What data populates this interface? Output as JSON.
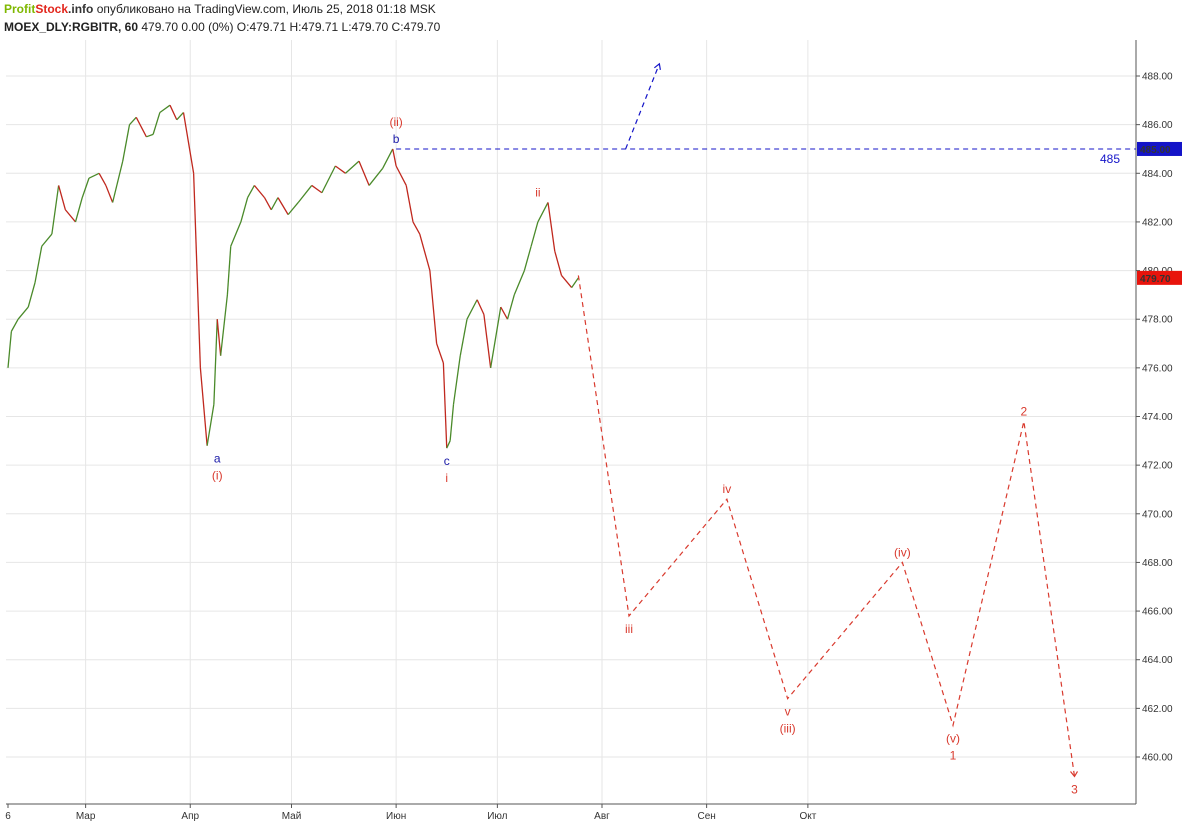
{
  "header": {
    "brand_profit": "Profit",
    "brand_stock": "Stock",
    "brand_domain": ".info",
    "published_text": "опубликовано на TradingView.com, Июль 25, 2018 01:18 MSK",
    "symbol": "MOEX_DLY:RGBITR, 60",
    "quote": "479.70 0.00 (0%) O:479.71 H:479.71 L:479.70 C:479.70"
  },
  "colors": {
    "up": "#4a8a2a",
    "down": "#c0281e",
    "grid": "#e6e6e6",
    "blue_label": "#1a1aa8",
    "red_label": "#d93a2e",
    "price_tag": "#e8140c",
    "level_tag": "#1414c8"
  },
  "chart_data": {
    "type": "line",
    "x_axis_labels": [
      "6",
      "Мар",
      "Апр",
      "Май",
      "Июн",
      "Июл",
      "Авг",
      "Сен",
      "Окт"
    ],
    "y_ticks": [
      "460.00",
      "462.00",
      "464.00",
      "466.00",
      "468.00",
      "470.00",
      "472.00",
      "474.00",
      "476.00",
      "478.00",
      "480.00",
      "482.00",
      "484.00",
      "486.00",
      "488.00"
    ],
    "ylim": [
      458.5,
      489.5
    ],
    "price_series": {
      "name": "MOEX_DLY:RGBITR",
      "x": [
        "2018-02-06",
        "2018-02-07",
        "2018-02-09",
        "2018-02-12",
        "2018-02-14",
        "2018-02-16",
        "2018-02-19",
        "2018-02-21",
        "2018-02-23",
        "2018-02-26",
        "2018-02-28",
        "2018-03-02",
        "2018-03-05",
        "2018-03-07",
        "2018-03-09",
        "2018-03-12",
        "2018-03-14",
        "2018-03-16",
        "2018-03-19",
        "2018-03-21",
        "2018-03-23",
        "2018-03-26",
        "2018-03-28",
        "2018-03-30",
        "2018-04-02",
        "2018-04-04",
        "2018-04-06",
        "2018-04-08",
        "2018-04-09",
        "2018-04-10",
        "2018-04-12",
        "2018-04-13",
        "2018-04-16",
        "2018-04-18",
        "2018-04-20",
        "2018-04-23",
        "2018-04-25",
        "2018-04-27",
        "2018-04-30",
        "2018-05-03",
        "2018-05-07",
        "2018-05-10",
        "2018-05-14",
        "2018-05-17",
        "2018-05-21",
        "2018-05-24",
        "2018-05-28",
        "2018-05-31",
        "2018-06-01",
        "2018-06-04",
        "2018-06-06",
        "2018-06-08",
        "2018-06-11",
        "2018-06-13",
        "2018-06-15",
        "2018-06-16",
        "2018-06-17",
        "2018-06-18",
        "2018-06-20",
        "2018-06-22",
        "2018-06-25",
        "2018-06-27",
        "2018-06-29",
        "2018-07-02",
        "2018-07-04",
        "2018-07-06",
        "2018-07-09",
        "2018-07-11",
        "2018-07-13",
        "2018-07-16",
        "2018-07-18",
        "2018-07-20",
        "2018-07-23",
        "2018-07-25"
      ],
      "y": [
        476.0,
        477.5,
        478.0,
        478.5,
        479.5,
        481.0,
        481.5,
        483.5,
        482.5,
        482.0,
        483.0,
        483.8,
        484.0,
        483.5,
        482.8,
        484.5,
        486.0,
        486.3,
        485.5,
        485.6,
        486.5,
        486.8,
        486.2,
        486.5,
        484.0,
        476.0,
        472.8,
        474.5,
        478.0,
        476.5,
        479.0,
        481.0,
        482.0,
        483.0,
        483.5,
        483.0,
        482.5,
        483.0,
        482.3,
        482.8,
        483.5,
        483.2,
        484.3,
        484.0,
        484.5,
        483.5,
        484.2,
        485.0,
        484.3,
        483.5,
        482.0,
        481.5,
        480.0,
        477.0,
        476.2,
        472.7,
        473.0,
        474.5,
        476.5,
        478.0,
        478.8,
        478.2,
        476.0,
        478.5,
        478.0,
        479.0,
        480.0,
        481.0,
        482.0,
        482.8,
        480.8,
        479.8,
        479.3,
        479.7
      ]
    },
    "projection_red": {
      "name": "",
      "x": [
        "2018-07-25",
        "2018-08-09",
        "2018-09-07",
        "2018-09-25",
        "2018-10-29",
        "2018-11-13",
        "2018-12-04",
        "2018-12-19"
      ],
      "y": [
        479.8,
        465.8,
        470.6,
        462.4,
        468.0,
        461.3,
        473.8,
        459.2
      ]
    },
    "projection_blue": {
      "name": "",
      "x": [
        "2018-08-08",
        "2018-08-18"
      ],
      "y": [
        485.0,
        488.5
      ]
    },
    "horizontal_level": {
      "value": 485.0,
      "label": "485.00",
      "caption": "485"
    },
    "last_price": {
      "value": 479.7,
      "label": "479.70"
    },
    "wave_labels": [
      {
        "text": "a",
        "date": "2018-04-09",
        "price": 472.8,
        "color": "blue",
        "position": "below",
        "row": 0
      },
      {
        "text": "(i)",
        "date": "2018-04-09",
        "price": 472.8,
        "color": "red",
        "position": "below",
        "row": 1
      },
      {
        "text": "(ii)",
        "date": "2018-06-01",
        "price": 485.0,
        "color": "red",
        "position": "above",
        "row": 1
      },
      {
        "text": "b",
        "date": "2018-06-01",
        "price": 485.0,
        "color": "blue",
        "position": "above",
        "row": 0
      },
      {
        "text": "c",
        "date": "2018-06-16",
        "price": 472.7,
        "color": "blue",
        "position": "below",
        "row": 0
      },
      {
        "text": "i",
        "date": "2018-06-16",
        "price": 472.7,
        "color": "red",
        "position": "below",
        "row": 1
      },
      {
        "text": "ii",
        "date": "2018-07-13",
        "price": 482.8,
        "color": "red",
        "position": "above",
        "row": 0
      },
      {
        "text": "iii",
        "date": "2018-08-09",
        "price": 465.8,
        "color": "red",
        "position": "below",
        "row": 0
      },
      {
        "text": "iv",
        "date": "2018-09-07",
        "price": 470.6,
        "color": "red",
        "position": "above",
        "row": 0
      },
      {
        "text": "v",
        "date": "2018-09-25",
        "price": 462.4,
        "color": "red",
        "position": "below",
        "row": 0
      },
      {
        "text": "(iii)",
        "date": "2018-09-25",
        "price": 462.4,
        "color": "red",
        "position": "below",
        "row": 1
      },
      {
        "text": "(iv)",
        "date": "2018-10-29",
        "price": 468.0,
        "color": "red",
        "position": "above",
        "row": 0
      },
      {
        "text": "(v)",
        "date": "2018-11-13",
        "price": 461.3,
        "color": "red",
        "position": "below",
        "row": 0
      },
      {
        "text": "1",
        "date": "2018-11-13",
        "price": 461.3,
        "color": "red",
        "position": "below",
        "row": 1
      },
      {
        "text": "2",
        "date": "2018-12-04",
        "price": 473.8,
        "color": "red",
        "position": "above",
        "row": 0
      },
      {
        "text": "3",
        "date": "2018-12-19",
        "price": 459.2,
        "color": "red",
        "position": "below",
        "row": 0
      }
    ],
    "grid": true,
    "title": ""
  }
}
